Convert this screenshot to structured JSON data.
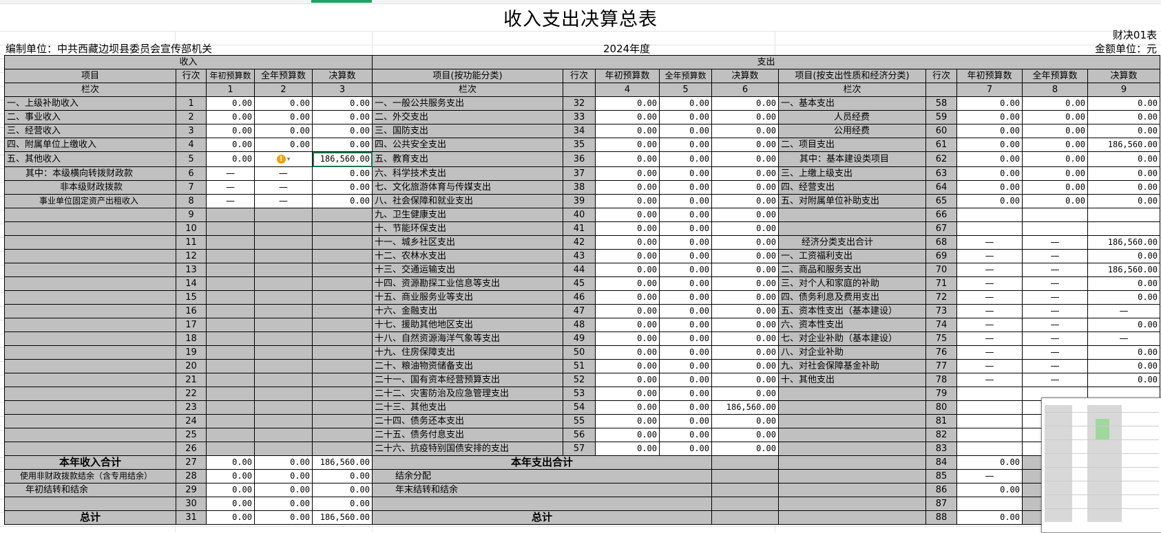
{
  "title": "收入支出决算总表",
  "form_code": "财决01表",
  "unit": "编制单位：中共西藏边坝县委员会宣传部机关",
  "year": "2024年度",
  "money_unit": "金额单位：元",
  "header": {
    "income": "收入",
    "expense": "支出",
    "item": "项目",
    "row_no": "行次",
    "initial_budget": "年初预算数",
    "annual_budget": "全年预算数",
    "final": "决算数",
    "func_item": "项目(按功能分类)",
    "econ_item": "项目(按支出性质和经济分类)",
    "col_label": "栏次",
    "col_nums": [
      "1",
      "2",
      "3",
      "4",
      "5",
      "6",
      "7",
      "8",
      "9"
    ]
  },
  "rows": [
    [
      {
        "t": "一、上级补助收入"
      },
      "1",
      "0.00",
      "0.00",
      "0.00",
      {
        "t": "一、一般公共服务支出"
      },
      "32",
      "0.00",
      "0.00",
      "0.00",
      {
        "t": "一、基本支出"
      },
      "58",
      "0.00",
      "0.00",
      "0.00"
    ],
    [
      {
        "t": "二、事业收入"
      },
      "2",
      "0.00",
      "0.00",
      "0.00",
      {
        "t": "二、外交支出"
      },
      "33",
      "0.00",
      "0.00",
      "0.00",
      {
        "t": "人员经费",
        "cls": "ind2"
      },
      "59",
      "0.00",
      "0.00",
      "0.00"
    ],
    [
      {
        "t": "三、经营收入"
      },
      "3",
      "0.00",
      "0.00",
      "0.00",
      {
        "t": "三、国防支出"
      },
      "34",
      "0.00",
      "0.00",
      "0.00",
      {
        "t": "公用经费",
        "cls": "ind2"
      },
      "60",
      "0.00",
      "0.00",
      "0.00"
    ],
    [
      {
        "t": "四、附属单位上缴收入"
      },
      "4",
      "0.00",
      "0.00",
      "0.00",
      {
        "t": "四、公共安全支出"
      },
      "35",
      "0.00",
      "0.00",
      "0.00",
      {
        "t": "二、项目支出"
      },
      "61",
      "0.00",
      "0.00",
      "186,560.00"
    ],
    [
      {
        "t": "五、其他收入"
      },
      "5",
      "0.00",
      "!",
      "186,560.00",
      {
        "t": "五、教育支出"
      },
      "36",
      "0.00",
      "0.00",
      "0.00",
      {
        "t": "其中：基本建设类项目",
        "cls": "ind4"
      },
      "62",
      "0.00",
      "0.00",
      "0.00"
    ],
    [
      {
        "t": "其中：本级横向转拨财政款",
        "cls": "ind4"
      },
      "6",
      "—",
      "—",
      "0.00",
      {
        "t": "六、科学技术支出"
      },
      "37",
      "0.00",
      "0.00",
      "0.00",
      {
        "t": "三、上缴上级支出"
      },
      "63",
      "0.00",
      "0.00",
      "0.00"
    ],
    [
      {
        "t": "非本级财政拨款",
        "cls": "ind2"
      },
      "7",
      "—",
      "—",
      "0.00",
      {
        "t": "七、文化旅游体育与传媒支出"
      },
      "38",
      "0.00",
      "0.00",
      "0.00",
      {
        "t": "四、经营支出"
      },
      "64",
      "0.00",
      "0.00",
      "0.00"
    ],
    [
      {
        "t": "事业单位固定资产出租收入",
        "cls": "ind3 sm"
      },
      "8",
      "—",
      "—",
      "0.00",
      {
        "t": "八、社会保障和就业支出"
      },
      "39",
      "0.00",
      "0.00",
      "0.00",
      {
        "t": "五、对附属单位补助支出"
      },
      "65",
      "0.00",
      "0.00",
      "0.00"
    ],
    [
      {
        "t": ""
      },
      "9",
      "",
      "",
      "",
      {
        "t": "九、卫生健康支出"
      },
      "40",
      "0.00",
      "0.00",
      "0.00",
      {
        "t": ""
      },
      "66",
      "",
      "",
      ""
    ],
    [
      {
        "t": ""
      },
      "10",
      "",
      "",
      "",
      {
        "t": "十、节能环保支出"
      },
      "41",
      "0.00",
      "0.00",
      "0.00",
      {
        "t": ""
      },
      "67",
      "",
      "",
      ""
    ],
    [
      {
        "t": ""
      },
      "11",
      "",
      "",
      "",
      {
        "t": "十一、城乡社区支出"
      },
      "42",
      "0.00",
      "0.00",
      "0.00",
      {
        "t": "经济分类支出合计",
        "cls": "ind1"
      },
      "68",
      "—",
      "—",
      "186,560.00"
    ],
    [
      {
        "t": ""
      },
      "12",
      "",
      "",
      "",
      {
        "t": "十二、农林水支出"
      },
      "43",
      "0.00",
      "0.00",
      "0.00",
      {
        "t": "一、工资福利支出"
      },
      "69",
      "—",
      "—",
      "0.00"
    ],
    [
      {
        "t": ""
      },
      "13",
      "",
      "",
      "",
      {
        "t": "十三、交通运输支出"
      },
      "44",
      "0.00",
      "0.00",
      "0.00",
      {
        "t": "二、商品和服务支出"
      },
      "70",
      "—",
      "—",
      "186,560.00"
    ],
    [
      {
        "t": ""
      },
      "14",
      "",
      "",
      "",
      {
        "t": "十四、资源勘探工业信息等支出"
      },
      "45",
      "0.00",
      "0.00",
      "0.00",
      {
        "t": "三、对个人和家庭的补助"
      },
      "71",
      "—",
      "—",
      "0.00"
    ],
    [
      {
        "t": ""
      },
      "15",
      "",
      "",
      "",
      {
        "t": "十五、商业服务业等支出"
      },
      "46",
      "0.00",
      "0.00",
      "0.00",
      {
        "t": "四、债务利息及费用支出"
      },
      "72",
      "—",
      "—",
      "0.00"
    ],
    [
      {
        "t": ""
      },
      "16",
      "",
      "",
      "",
      {
        "t": "十六、金融支出"
      },
      "47",
      "0.00",
      "0.00",
      "0.00",
      {
        "t": "五、资本性支出（基本建设）"
      },
      "73",
      "—",
      "—",
      "—"
    ],
    [
      {
        "t": ""
      },
      "17",
      "",
      "",
      "",
      {
        "t": "十七、援助其他地区支出"
      },
      "48",
      "0.00",
      "0.00",
      "0.00",
      {
        "t": "六、资本性支出"
      },
      "74",
      "—",
      "—",
      "0.00"
    ],
    [
      {
        "t": ""
      },
      "18",
      "",
      "",
      "",
      {
        "t": "十八、自然资源海洋气象等支出"
      },
      "49",
      "0.00",
      "0.00",
      "0.00",
      {
        "t": "七、对企业补助（基本建设）"
      },
      "75",
      "—",
      "—",
      "—"
    ],
    [
      {
        "t": ""
      },
      "19",
      "",
      "",
      "",
      {
        "t": "十九、住房保障支出"
      },
      "50",
      "0.00",
      "0.00",
      "0.00",
      {
        "t": "八、对企业补助"
      },
      "76",
      "—",
      "—",
      "0.00"
    ],
    [
      {
        "t": ""
      },
      "20",
      "",
      "",
      "",
      {
        "t": "二十、粮油物资储备支出"
      },
      "51",
      "0.00",
      "0.00",
      "0.00",
      {
        "t": "九、对社会保障基金补助"
      },
      "77",
      "—",
      "—",
      "0.00"
    ],
    [
      {
        "t": ""
      },
      "21",
      "",
      "",
      "",
      {
        "t": "二十一、国有资本经营预算支出"
      },
      "52",
      "0.00",
      "0.00",
      "0.00",
      {
        "t": "十、其他支出"
      },
      "78",
      "—",
      "—",
      "0.00"
    ],
    [
      {
        "t": ""
      },
      "22",
      "",
      "",
      "",
      {
        "t": "二十二、灾害防治及应急管理支出"
      },
      "53",
      "0.00",
      "0.00",
      "0.00",
      {
        "t": ""
      },
      "79",
      "",
      "",
      ""
    ],
    [
      {
        "t": ""
      },
      "23",
      "",
      "",
      "",
      {
        "t": "二十三、其他支出"
      },
      "54",
      "0.00",
      "0.00",
      "186,560.00",
      {
        "t": ""
      },
      "80",
      "",
      "",
      ""
    ],
    [
      {
        "t": ""
      },
      "24",
      "",
      "",
      "",
      {
        "t": "二十四、债务还本支出"
      },
      "55",
      "0.00",
      "0.00",
      "0.00",
      {
        "t": ""
      },
      "81",
      "",
      "",
      ""
    ],
    [
      {
        "t": ""
      },
      "25",
      "",
      "",
      "",
      {
        "t": "二十五、债务付息支出"
      },
      "56",
      "0.00",
      "0.00",
      "0.00",
      {
        "t": ""
      },
      "82",
      "",
      "",
      ""
    ],
    [
      {
        "t": ""
      },
      "26",
      "",
      "",
      "",
      {
        "t": "二十六、抗疫特别国债安排的支出"
      },
      "57",
      "0.00",
      "0.00",
      "0.00",
      {
        "t": ""
      },
      "83",
      "",
      "",
      ""
    ]
  ],
  "bottom": {
    "income_total": {
      "label": "本年收入合计",
      "no": "27",
      "v1": "0.00",
      "v2": "0.00",
      "v3": "186,560.00"
    },
    "non_fiscal": {
      "label": "使用非财政拨款结余（含专用结余）",
      "no": "28",
      "v1": "0.00",
      "v2": "0.00",
      "v3": "0.00"
    },
    "carry_in": {
      "label": "年初结转和结余",
      "no": "29",
      "v1": "0.00",
      "v2": "0.00",
      "v3": "0.00"
    },
    "blank30": {
      "no": "30",
      "v1": "0.00",
      "v2": "0.00",
      "v3": "0.00"
    },
    "grand": {
      "label": "总计",
      "no": "31",
      "v1": "0.00",
      "v2": "0.00",
      "v3": "186,560.00"
    },
    "expense_total": {
      "label": "本年支出合计",
      "no": "84",
      "v7": "0.00"
    },
    "distribution": {
      "label": "结余分配",
      "no": "85",
      "v7": "—"
    },
    "carry_out": {
      "label": "年末结转和结余",
      "no": "86",
      "v7": "0.00"
    },
    "blank87": {
      "no": "87"
    },
    "grand_exp": {
      "label": "总计",
      "no": "88",
      "v7": "0.00"
    }
  }
}
